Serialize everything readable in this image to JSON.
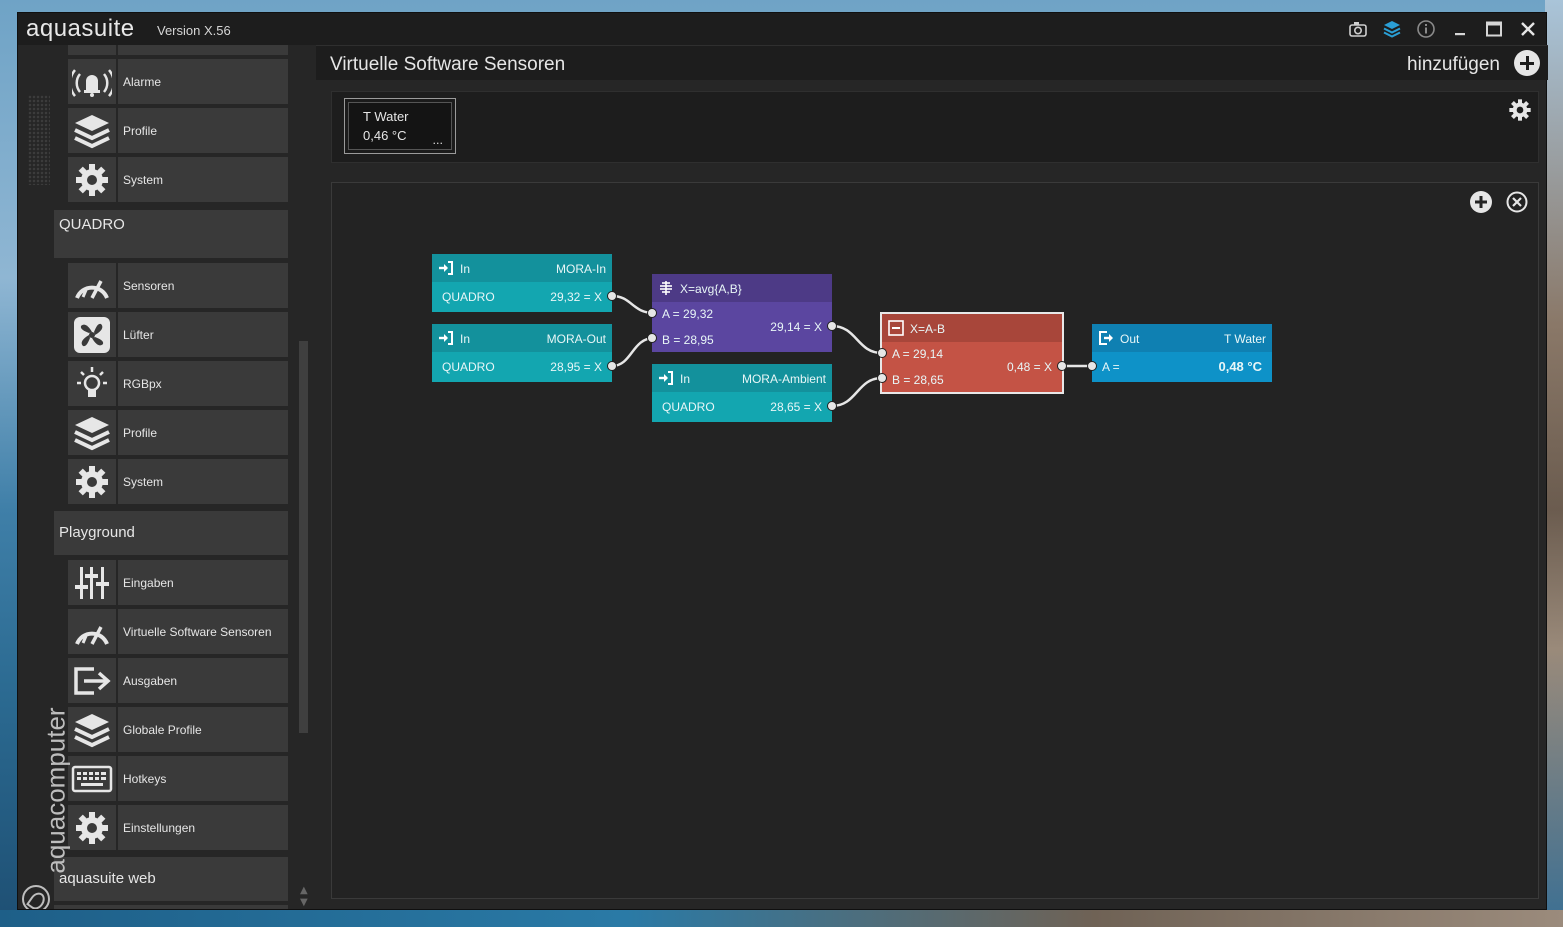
{
  "window": {
    "app_name": "aquasuite",
    "version": "Version X.56",
    "title_icons": [
      "camera-icon",
      "layers-icon",
      "info-icon",
      "minimize-icon",
      "maximize-icon",
      "close-icon"
    ]
  },
  "sidebar": {
    "brand_text": "aquacomputer",
    "group1_items": [
      {
        "label": "Alarme",
        "icon": "bell-icon"
      },
      {
        "label": "Profile",
        "icon": "layers-icon"
      },
      {
        "label": "System",
        "icon": "gear-icon"
      }
    ],
    "quadro_title": "QUADRO",
    "quadro_items": [
      {
        "label": "Sensoren",
        "icon": "gauge-icon"
      },
      {
        "label": "Lüfter",
        "icon": "fan-icon"
      },
      {
        "label": "RGBpx",
        "icon": "bulb-icon"
      },
      {
        "label": "Profile",
        "icon": "layers-icon"
      },
      {
        "label": "System",
        "icon": "gear-icon"
      }
    ],
    "playground_title": "Playground",
    "playground_items": [
      {
        "label": "Eingaben",
        "icon": "sliders-icon"
      },
      {
        "label": "Virtuelle Software Sensoren",
        "icon": "gauge-icon"
      },
      {
        "label": "Ausgaben",
        "icon": "export-icon"
      },
      {
        "label": "Globale Profile",
        "icon": "layers-icon"
      },
      {
        "label": "Hotkeys",
        "icon": "keyboard-icon"
      },
      {
        "label": "Einstellungen",
        "icon": "gear-icon"
      }
    ],
    "web_title": "aquasuite web"
  },
  "main": {
    "title": "Virtuelle Software Sensoren",
    "add_label": "hinzufügen",
    "sensor_tile": {
      "name": "T Water",
      "value": "0,46 °C",
      "more": "..."
    }
  },
  "nodes": {
    "in1": {
      "tag": "In",
      "name": "MORA-In",
      "source": "QUADRO",
      "output": "29,32 = X"
    },
    "in2": {
      "tag": "In",
      "name": "MORA-Out",
      "source": "QUADRO",
      "output": "28,95 = X"
    },
    "in3": {
      "tag": "In",
      "name": "MORA-Ambient",
      "source": "QUADRO",
      "output": "28,65 = X"
    },
    "avg": {
      "formula": "X=avg{A,B}",
      "a": "A = 29,32",
      "b": "B = 28,95",
      "output": "29,14 = X"
    },
    "sub": {
      "formula": "X=A-B",
      "a": "A = 29,14",
      "b": "B = 28,65",
      "output": "0,48 = X"
    },
    "out": {
      "tag": "Out",
      "name": "T Water",
      "a": "A =",
      "value": "0,48 °C"
    }
  },
  "colors": {
    "teal": "#13a6b0",
    "purple": "#5b46a0",
    "red": "#c45345",
    "blue": "#0e92c8",
    "window_bg": "#262626"
  }
}
